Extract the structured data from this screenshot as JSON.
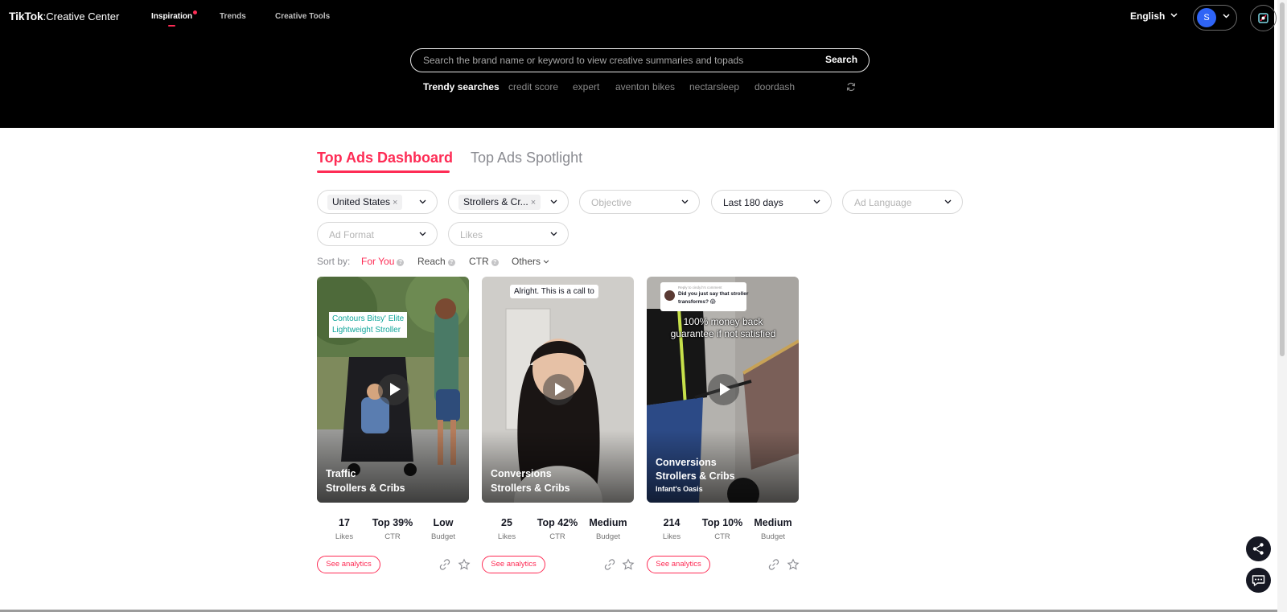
{
  "header": {
    "brand_main": "TikTok",
    "brand_sub": ":Creative Center",
    "nav": [
      {
        "label": "Inspiration",
        "active": true
      },
      {
        "label": "Trends",
        "active": false
      },
      {
        "label": "Creative Tools",
        "active": false
      }
    ],
    "language": "English",
    "avatar_initial": "S"
  },
  "search": {
    "placeholder": "Search the brand name or keyword to view creative summaries and topads",
    "button_label": "Search",
    "trendy_label": "Trendy searches",
    "trendy_items": [
      "credit score",
      "expert",
      "aventon bikes",
      "nectarsleep",
      "doordash"
    ]
  },
  "tabs": [
    {
      "label": "Top Ads Dashboard",
      "active": true
    },
    {
      "label": "Top Ads Spotlight",
      "active": false
    }
  ],
  "filters": {
    "region": {
      "chip": "United States",
      "remove": "×"
    },
    "industry": {
      "chip": "Strollers & Cr...",
      "remove": "×"
    },
    "objective": {
      "placeholder": "Objective"
    },
    "period": {
      "value": "Last 180 days"
    },
    "ad_language": {
      "placeholder": "Ad Language"
    },
    "ad_format": {
      "placeholder": "Ad Format"
    },
    "likes": {
      "placeholder": "Likes"
    }
  },
  "sort": {
    "label": "Sort by:",
    "options": [
      {
        "label": "For You",
        "active": true,
        "help": "?"
      },
      {
        "label": "Reach",
        "active": false,
        "help": "?"
      },
      {
        "label": "CTR",
        "active": false,
        "help": "?"
      },
      {
        "label": "Others",
        "active": false
      }
    ]
  },
  "cards": [
    {
      "objective": "Traffic",
      "industry": "Strollers & Cribs",
      "brand": "",
      "overlay_text": [
        "Contours Bitsy' Elite",
        "Lightweight Stroller"
      ],
      "stats": [
        {
          "value": "17",
          "label": "Likes"
        },
        {
          "value": "Top 39%",
          "label": "CTR"
        },
        {
          "value": "Low",
          "label": "Budget"
        }
      ],
      "analytics_label": "See analytics"
    },
    {
      "objective": "Conversions",
      "industry": "Strollers & Cribs",
      "brand": "",
      "overlay_text": [
        "Alright. This is a call to"
      ],
      "stats": [
        {
          "value": "25",
          "label": "Likes"
        },
        {
          "value": "Top 42%",
          "label": "CTR"
        },
        {
          "value": "Medium",
          "label": "Budget"
        }
      ],
      "analytics_label": "See analytics"
    },
    {
      "objective": "Conversions",
      "industry": "Strollers & Cribs",
      "brand": "Infant's Oasis",
      "overlay_text": [
        "100% money back",
        "guarantee if not satisfied"
      ],
      "comment": {
        "reply": "Reply to cindy.h's comment",
        "text1": "Did you just say that stroller",
        "text2": "transforms? 😱"
      },
      "stats": [
        {
          "value": "214",
          "label": "Likes"
        },
        {
          "value": "Top 10%",
          "label": "CTR"
        },
        {
          "value": "Medium",
          "label": "Budget"
        }
      ],
      "analytics_label": "See analytics"
    }
  ],
  "colors": {
    "accent": "#fe2c55",
    "header_bg": "#000000",
    "avatar": "#2f64f6"
  },
  "icons": [
    "chevron-down-icon",
    "refresh-icon",
    "play-icon",
    "link-icon",
    "star-icon",
    "share-icon",
    "chat-icon",
    "creative-center-icon",
    "help-icon"
  ]
}
